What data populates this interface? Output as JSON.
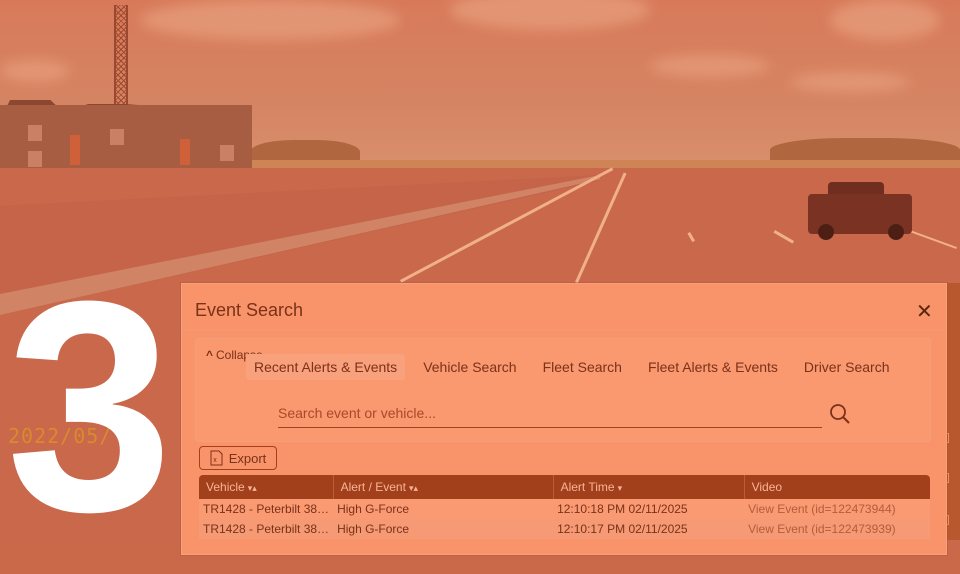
{
  "background": {
    "timestamp_overlay": "2022/05/",
    "timestamp_overlay_tail": "3",
    "step_number": "3"
  },
  "modal": {
    "title": "Event Search",
    "close_icon": "close-icon",
    "collapse_label": "Collapse",
    "tabs": [
      {
        "label": "Recent Alerts & Events",
        "active": true
      },
      {
        "label": "Vehicle Search",
        "active": false
      },
      {
        "label": "Fleet Search",
        "active": false
      },
      {
        "label": "Fleet Alerts & Events",
        "active": false
      },
      {
        "label": "Driver Search",
        "active": false
      }
    ],
    "search": {
      "placeholder": "Search event or vehicle...",
      "value": "",
      "icon": "search-icon"
    },
    "export_label": "Export",
    "table": {
      "columns": [
        {
          "label": "Vehicle",
          "sort": "▾▴"
        },
        {
          "label": "Alert / Event",
          "sort": "▾▴"
        },
        {
          "label": "Alert Time",
          "sort": "▾"
        },
        {
          "label": "Video",
          "sort": ""
        }
      ],
      "rows": [
        {
          "vehicle": "TR1428 - Peterbilt 38…",
          "event": "High G-Force",
          "time": "12:10:18 PM 02/11/2025",
          "video": "View Event (id=122473944)"
        },
        {
          "vehicle": "TR1428 - Peterbilt 38…",
          "event": "High G-Force",
          "time": "12:10:17 PM 02/11/2025",
          "video": "View Event (id=122473939)"
        }
      ]
    }
  },
  "colors": {
    "tint": "#f8936a",
    "header": "#a3401c",
    "text": "#7b3218"
  }
}
